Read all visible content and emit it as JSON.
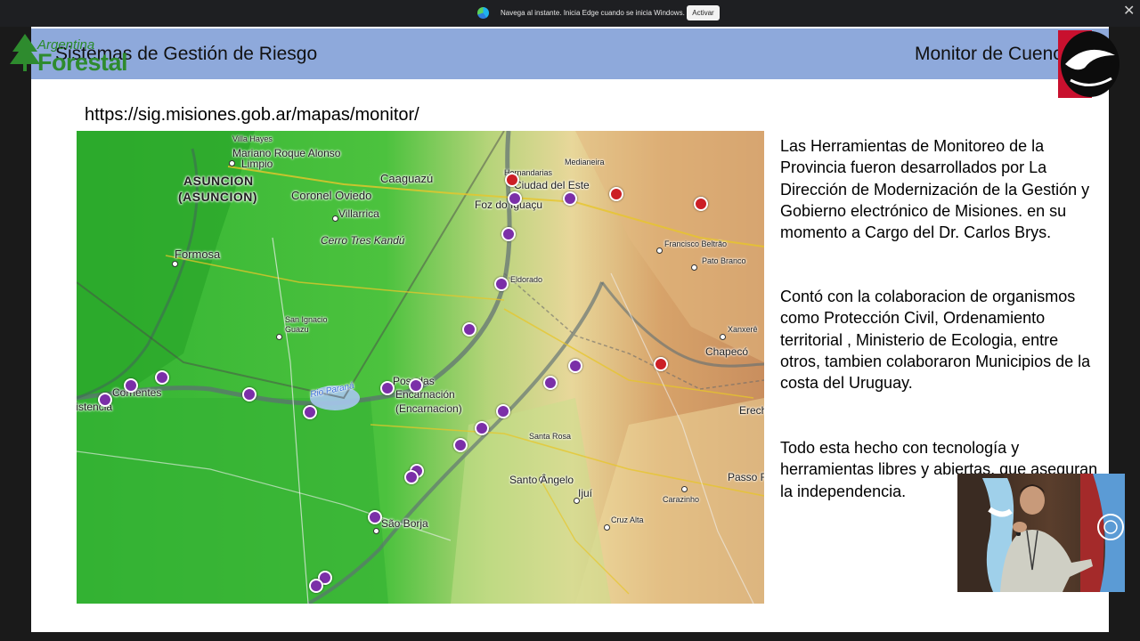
{
  "notification": {
    "text": "Navega al instante. Inicia Edge cuando se inicia Windows.",
    "button_label": "Activar",
    "close_glyph": "✕"
  },
  "slide": {
    "title_left": "Sistemas de Gestión de Riesgo",
    "title_right": "Monitor de Cuencas",
    "url": "https://sig.misiones.gob.ar/mapas/monitor/",
    "header_color": "#8ea9db"
  },
  "logo": {
    "line1": "Argentina",
    "line2": "Forestal"
  },
  "map": {
    "labels": {
      "villa_hayes": "Villa Hayes",
      "mariano": "Mariano Roque Alonso",
      "limpio": "Limpio",
      "asuncion1": "ASUNCION",
      "asuncion2": "(ASUNCION)",
      "caaguazu": "Caaguazú",
      "coronel": "Coronel Oviedo",
      "villarrica": "Villarrica",
      "cerro": "Cerro Tres Kandú",
      "formosa": "Formosa",
      "hernandarias": "Hernandarias",
      "ciudad_este": "Ciudad del Este",
      "medianeira": "Medianeira",
      "foz": "Foz do Iguaçu",
      "eldorado": "Eldorado",
      "san_ignacio1": "San Ignacio",
      "san_ignacio2": "Guazu",
      "rio_parana": "Rio Paraná",
      "posadas": "Posadas",
      "encarnacion1": "Encarnación",
      "encarnacion2": "(Encarnacion)",
      "corrientes": "Corrientes",
      "resistencia": "Resistencia",
      "santa_rosa": "Santa Rosa",
      "santo_angelo": "Santo Ângelo",
      "ijui": "Ijuí",
      "cruz_alta": "Cruz Alta",
      "sao_borja": "São Borja",
      "francisco": "Francisco Beltrão",
      "pato_branco": "Pato Branco",
      "xanxere": "Xanxerê",
      "chapeco": "Chapecó",
      "erechim": "Erechim",
      "passo_fundo": "Passo Fundo",
      "carazinho": "Carazinho"
    },
    "marker_colors": {
      "purple": "#7b2fa8",
      "red": "#cc1f26"
    }
  },
  "paragraphs": {
    "p1": "Las Herramientas de Monitoreo de la Provincia fueron desarrollados por La Dirección de Modernización de la Gestión y Gobierno electrónico de Misiones. en su momento a Cargo del Dr. Carlos Brys.",
    "p2": "Contó con la colaboracion de organismos como Protección Civil, Ordenamiento territorial , Ministerio de Ecologia, entre otros, tambien colaboraron Municipios de la costa del Uruguay.",
    "p3": "Todo esta hecho con tecnología y herramientas libres y abiertas, que aseguran la independencia."
  }
}
